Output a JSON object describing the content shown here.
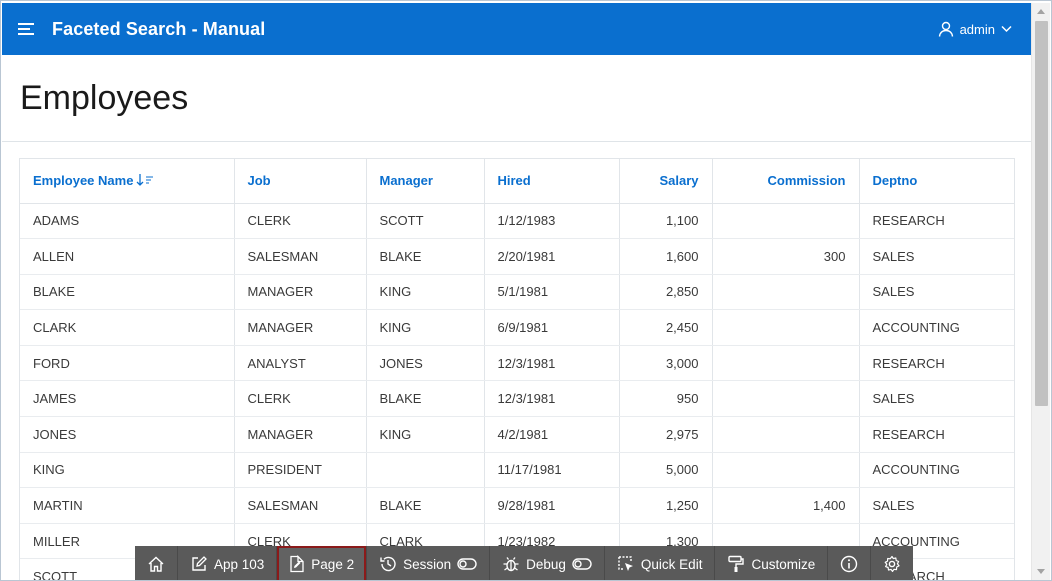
{
  "header": {
    "app_title": "Faceted Search - Manual",
    "user_name": "admin"
  },
  "page": {
    "title": "Employees"
  },
  "report": {
    "columns": [
      "Employee Name",
      "Job",
      "Manager",
      "Hired",
      "Salary",
      "Commission",
      "Deptno"
    ],
    "rows": [
      [
        "ADAMS",
        "CLERK",
        "SCOTT",
        "1/12/1983",
        "1,100",
        "",
        "RESEARCH"
      ],
      [
        "ALLEN",
        "SALESMAN",
        "BLAKE",
        "2/20/1981",
        "1,600",
        "300",
        "SALES"
      ],
      [
        "BLAKE",
        "MANAGER",
        "KING",
        "5/1/1981",
        "2,850",
        "",
        "SALES"
      ],
      [
        "CLARK",
        "MANAGER",
        "KING",
        "6/9/1981",
        "2,450",
        "",
        "ACCOUNTING"
      ],
      [
        "FORD",
        "ANALYST",
        "JONES",
        "12/3/1981",
        "3,000",
        "",
        "RESEARCH"
      ],
      [
        "JAMES",
        "CLERK",
        "BLAKE",
        "12/3/1981",
        "950",
        "",
        "SALES"
      ],
      [
        "JONES",
        "MANAGER",
        "KING",
        "4/2/1981",
        "2,975",
        "",
        "RESEARCH"
      ],
      [
        "KING",
        "PRESIDENT",
        "",
        "11/17/1981",
        "5,000",
        "",
        "ACCOUNTING"
      ],
      [
        "MARTIN",
        "SALESMAN",
        "BLAKE",
        "9/28/1981",
        "1,250",
        "1,400",
        "SALES"
      ],
      [
        "MILLER",
        "CLERK",
        "CLARK",
        "1/23/1982",
        "1,300",
        "",
        "ACCOUNTING"
      ],
      [
        "SCOTT",
        "",
        "",
        "",
        "",
        "",
        "RESEARCH"
      ]
    ]
  },
  "devbar": {
    "app_label": "App 103",
    "page_label": "Page 2",
    "session_label": "Session",
    "debug_label": "Debug",
    "quick_edit_label": "Quick Edit",
    "customize_label": "Customize"
  },
  "colors": {
    "header_bg": "#0a6fcf",
    "link": "#0a6fcf",
    "devbar_bg": "#5a5a5a",
    "active_outline": "#8b1a1a"
  }
}
